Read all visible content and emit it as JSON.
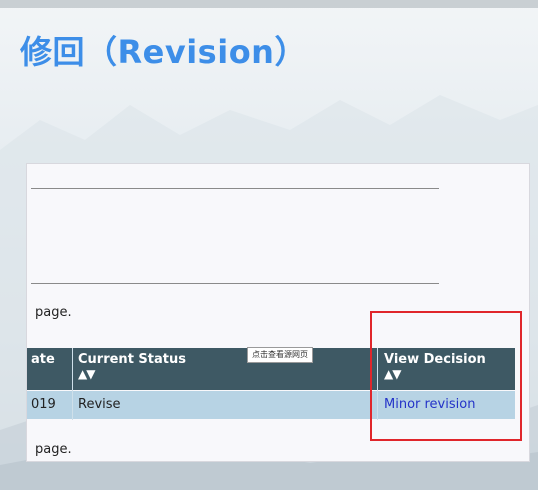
{
  "slide": {
    "title": "修回（Revision）"
  },
  "screenshot": {
    "page_text_top": "page.",
    "page_text_bottom": "page.",
    "table": {
      "headers": [
        {
          "label": "Date",
          "visible": "ate",
          "sort_arrows": ""
        },
        {
          "label": "Current Status",
          "sort_arrows": "▲▼"
        },
        {
          "label": "View Decision",
          "sort_arrows": "▲▼"
        }
      ],
      "rows": [
        {
          "date": "019",
          "status": "Revise",
          "decision": "Minor revision"
        }
      ]
    },
    "tooltip": "点击查看源网页"
  },
  "colors": {
    "title": "#3d8ee8",
    "table_header_bg": "#3e5964",
    "table_row_bg": "#b7d3e4",
    "link": "#2433c8",
    "highlight_box": "#e0262b"
  }
}
